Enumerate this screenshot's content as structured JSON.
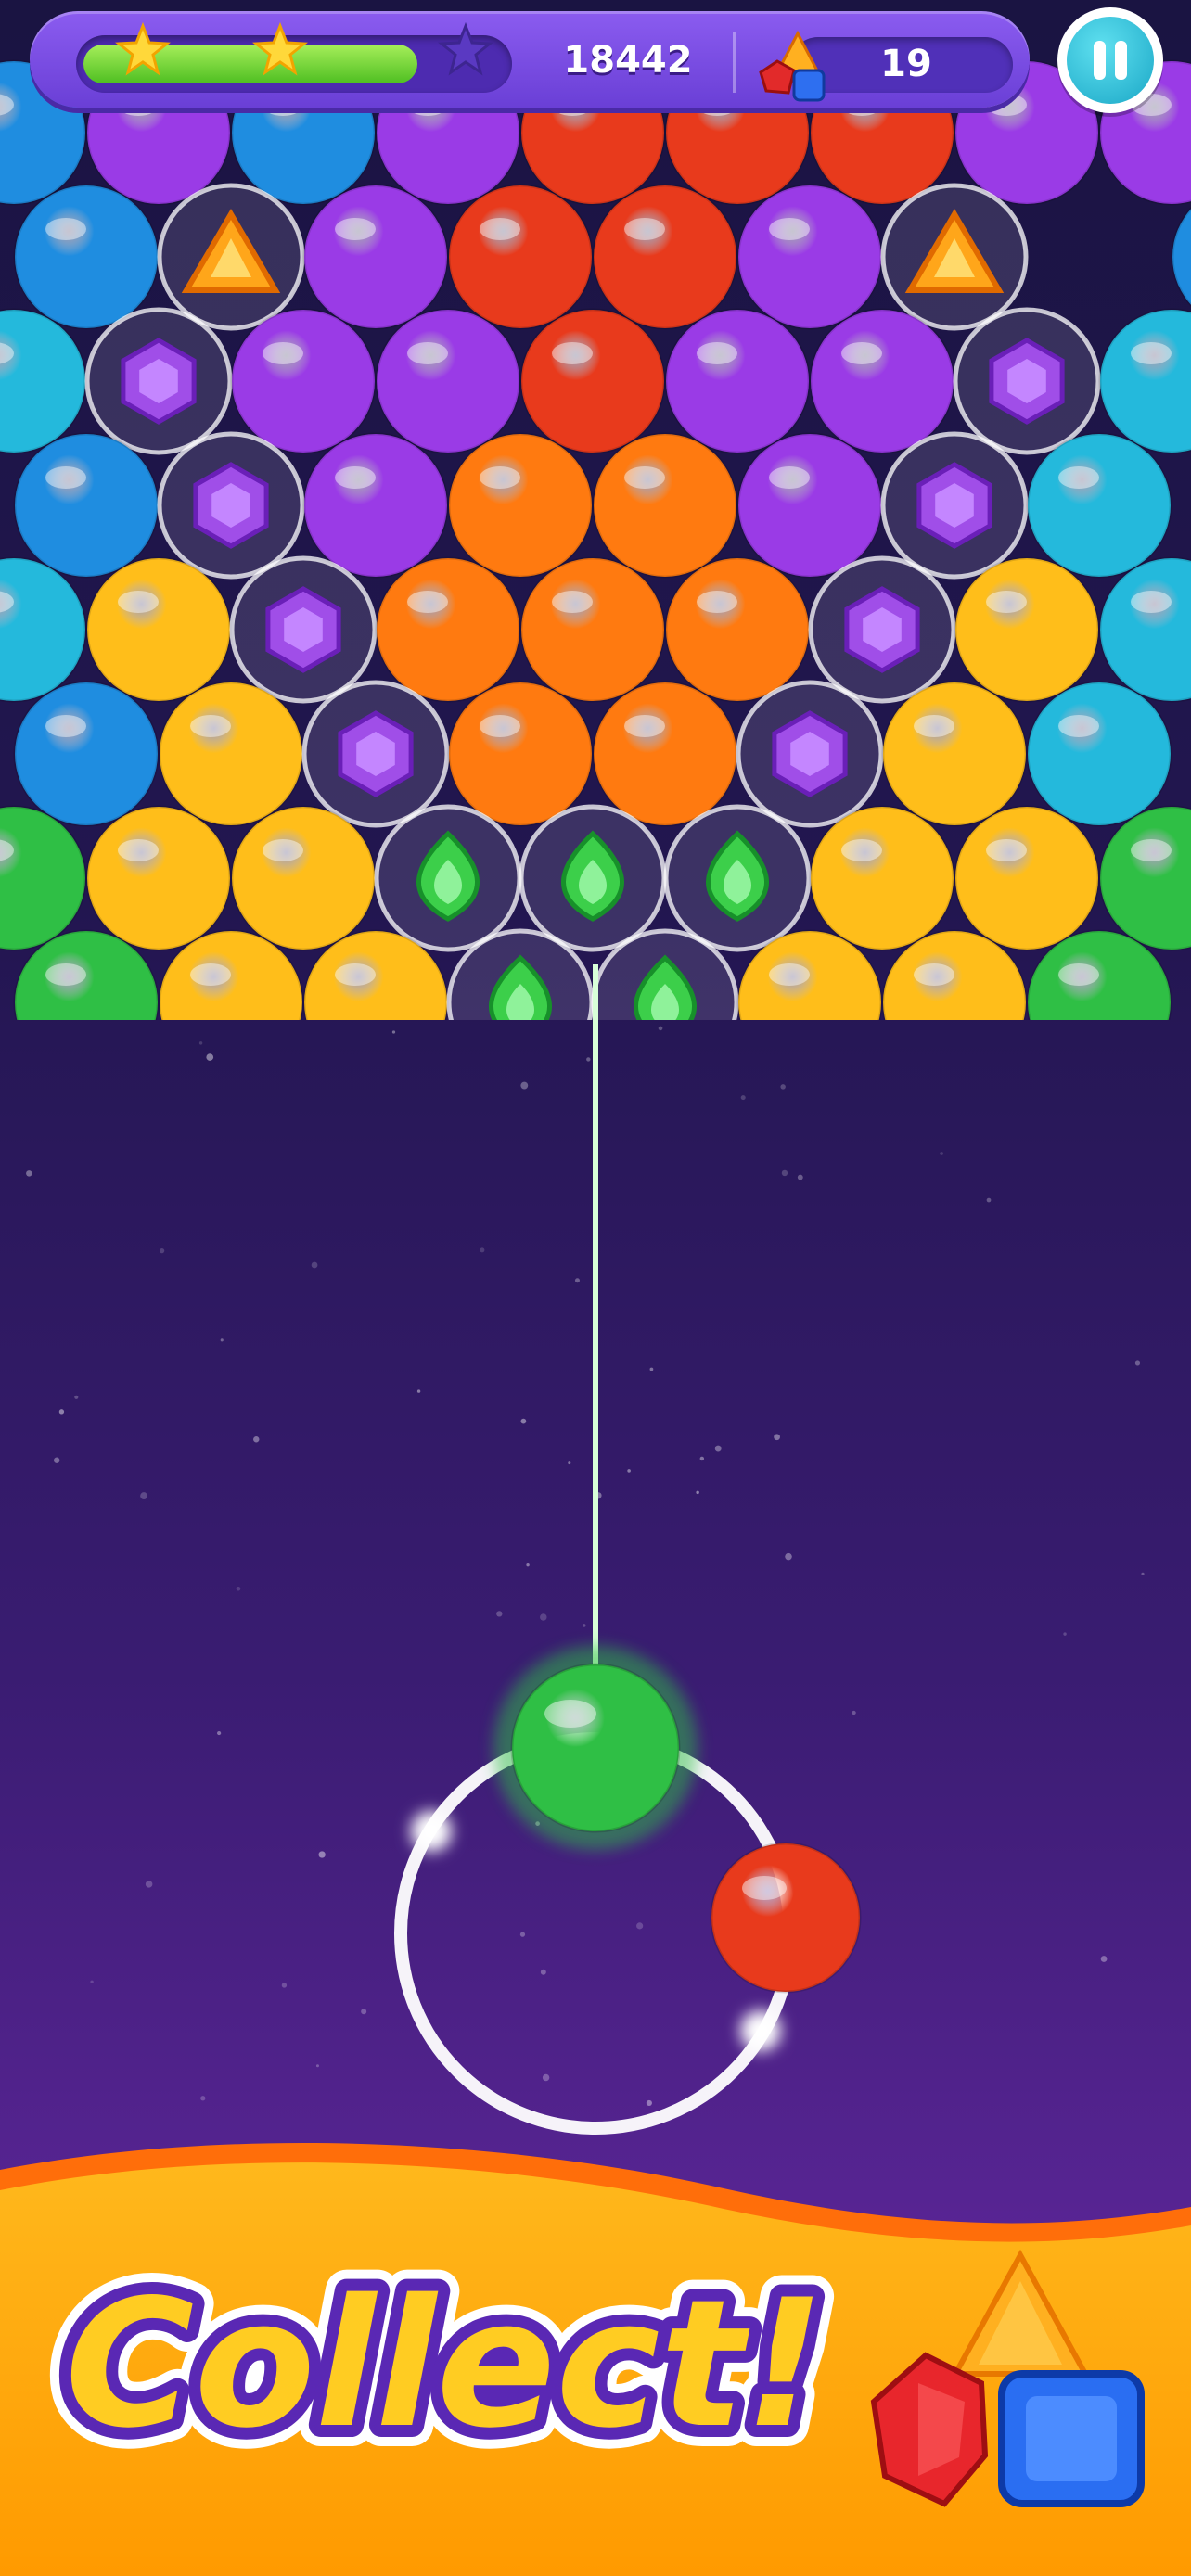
{
  "hud": {
    "score": "18442",
    "gems": "19",
    "progress_fraction": 0.9,
    "stars_earned": 2,
    "stars_total": 3
  },
  "board": {
    "rows": [
      "BPBPRRRPP",
      "BTPRRPT B",
      "CAPPRPPAC",
      "BAPOOPAC",
      "CYAOOOAYC",
      "BYAOOAYC",
      "GYYEEEYYG",
      "GYYEEYYG"
    ]
  },
  "shooter": {
    "current_color": "green",
    "next_color": "red"
  },
  "banner": {
    "text": "Collect!"
  },
  "colors": {
    "red": "#e83a1c",
    "orange": "#ff7a10",
    "yellow": "#ffbe1a",
    "green": "#2fbf45",
    "blue": "#1f8de0",
    "cyan": "#24b9dc",
    "purple": "#9a3be6",
    "aim_line": "#39ff4a"
  }
}
